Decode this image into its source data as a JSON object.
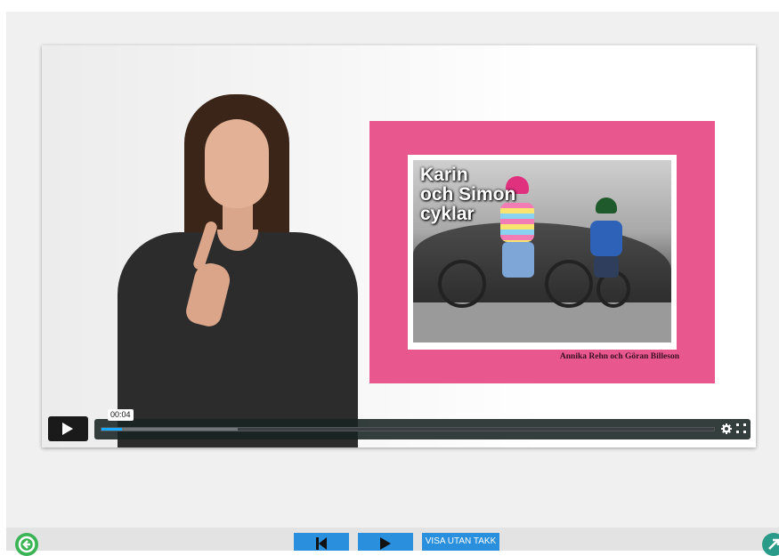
{
  "video": {
    "current_time": "00:04",
    "progress": 0.034,
    "buffered": 0.223,
    "settings_icon": "gear-icon",
    "fullscreen_icon": "expand-icon",
    "play_icon": "play-icon"
  },
  "book": {
    "title": "Karin\noch Simon\ncyklar",
    "authors": "Annika Rehn och Göran Billeson",
    "cover_color": "#e8588f"
  },
  "navigation": {
    "back_icon": "arrow-left-circle-icon",
    "prev_icon": "skip-previous-icon",
    "next_icon": "play-next-icon",
    "visa_label": "VISA UTAN TAKK",
    "expand_icon": "expand-arrows-icon",
    "accent": "#2a8fdd"
  }
}
